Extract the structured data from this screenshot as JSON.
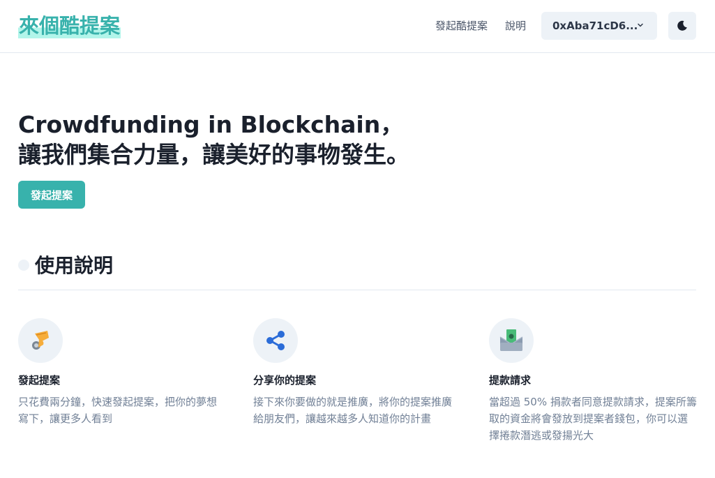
{
  "header": {
    "logo": "來個酷提案",
    "nav": {
      "propose": "發起酷提案",
      "help": "說明"
    },
    "wallet": {
      "address": "0xAba71cD6..."
    },
    "theme_toggle_icon": "moon-icon"
  },
  "hero": {
    "line1": "Crowdfunding in Blockchain，",
    "line2": "讓我們集合力量，讓美好的事物發生。",
    "cta_label": "發起提案"
  },
  "instructions": {
    "title": "使用說明",
    "features": [
      {
        "icon": "hand-with-card-icon",
        "title": "發起提案",
        "desc": "只花費兩分鐘，快速發起提案，把你的夢想寫下，讓更多人看到"
      },
      {
        "icon": "share-icon",
        "title": "分享你的提案",
        "desc": "接下來你要做的就是推廣，將你的提案推廣給朋友們，讓越來越多人知道你的計畫"
      },
      {
        "icon": "money-envelope-icon",
        "title": "提款請求",
        "desc": "當超過 50% 捐款者同意提款請求，提案所籌取的資金將會發放到提案者錢包，你可以選擇捲款潛逃或發揚光大"
      }
    ]
  },
  "colors": {
    "accent": "#38b2ac",
    "accent_light": "#b2f5ea",
    "muted": "#edf2f7",
    "text_muted": "#718096"
  }
}
